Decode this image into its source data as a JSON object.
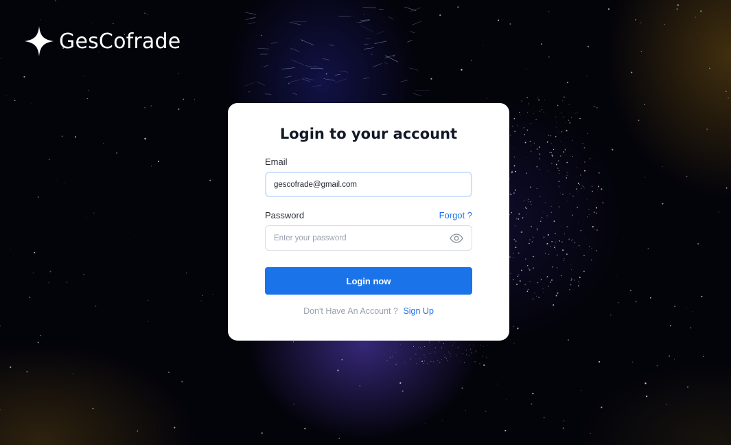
{
  "brand": {
    "name": "GesCofrade"
  },
  "form": {
    "title": "Login to your account",
    "email": {
      "label": "Email",
      "value": "gescofrade@gmail.com"
    },
    "password": {
      "label": "Password",
      "forgot_label": "Forgot ?",
      "placeholder": "Enter your password"
    },
    "submit_label": "Login now",
    "no_account_text": "Don't Have An Account ?",
    "signup_label": "Sign Up"
  },
  "icons": {
    "logo": "four-point-star-icon",
    "password_toggle": "eye-icon"
  },
  "colors": {
    "accent": "#1a73e8",
    "card_bg": "#ffffff",
    "background": "#03030a",
    "title_text": "#121826"
  }
}
